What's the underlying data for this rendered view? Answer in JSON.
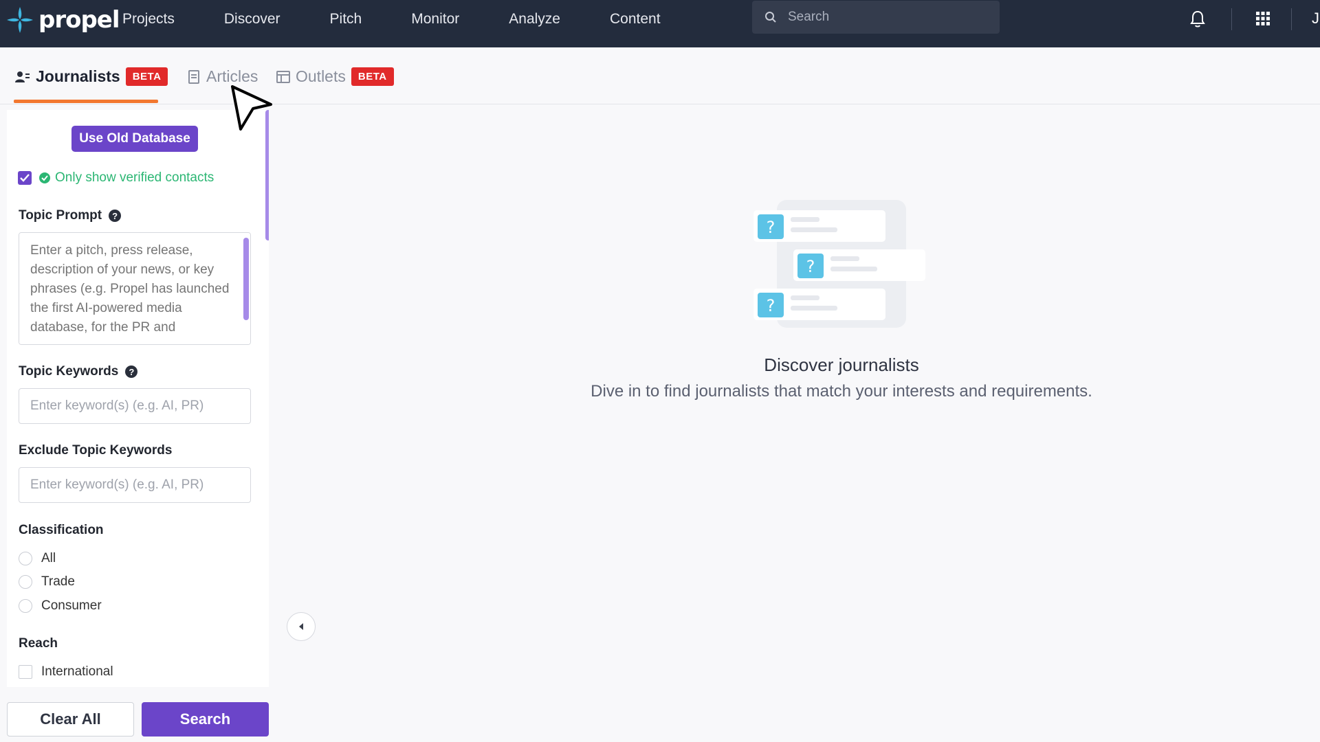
{
  "brand": {
    "name": "propel",
    "accent": "#6b45c9",
    "nav_bg": "#232c3d"
  },
  "nav": {
    "items": [
      "Projects",
      "Discover",
      "Pitch",
      "Monitor",
      "Analyze",
      "Content"
    ],
    "search_placeholder": "Search",
    "user_initial": "J"
  },
  "tabs": [
    {
      "label": "Journalists",
      "badge": "BETA",
      "active": true
    },
    {
      "label": "Articles",
      "badge": "",
      "active": false
    },
    {
      "label": "Outlets",
      "badge": "BETA",
      "active": false
    }
  ],
  "sidebar": {
    "use_old_db_label": "Use Old Database",
    "verified_label": "Only show verified contacts",
    "topic_prompt_label": "Topic Prompt",
    "topic_prompt_placeholder": "Enter a pitch, press release, description of your news, or key phrases (e.g. Propel has launched the first AI-powered media database, for the PR and",
    "topic_keywords_label": "Topic Keywords",
    "topic_keywords_placeholder": "Enter keyword(s) (e.g. AI, PR)",
    "exclude_keywords_label": "Exclude Topic Keywords",
    "exclude_keywords_placeholder": "Enter keyword(s) (e.g. AI, PR)",
    "classification_label": "Classification",
    "classification_options": [
      "All",
      "Trade",
      "Consumer"
    ],
    "reach_label": "Reach",
    "reach_options": [
      "International"
    ],
    "clear_label": "Clear All",
    "search_label": "Search"
  },
  "main": {
    "empty_title": "Discover journalists",
    "empty_subtitle": "Dive in to find journalists that match your interests and requirements."
  }
}
